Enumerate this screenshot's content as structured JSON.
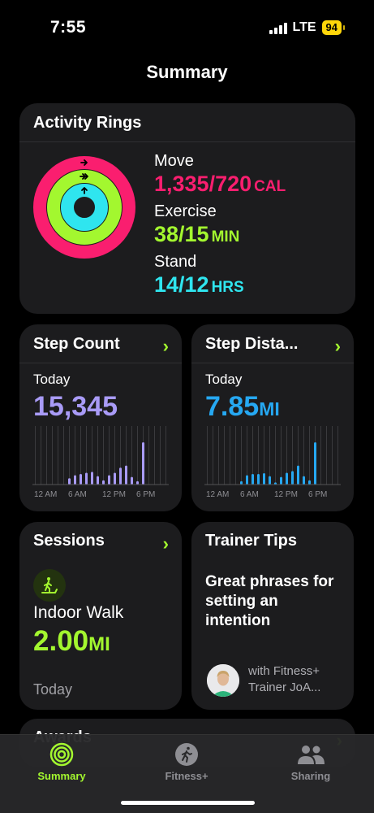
{
  "status": {
    "time": "7:55",
    "network": "LTE",
    "battery": "94"
  },
  "page_title": "Summary",
  "activity": {
    "title": "Activity Rings",
    "move": {
      "label": "Move",
      "value": "1,335/720",
      "unit": "CAL",
      "color": "#fa1e6f",
      "progress": 1.854
    },
    "exercise": {
      "label": "Exercise",
      "value": "38/15",
      "unit": "MIN",
      "color": "#a3f72f",
      "progress": 2.53
    },
    "stand": {
      "label": "Stand",
      "value": "14/12",
      "unit": "HRS",
      "color": "#2fe5ef",
      "progress": 1.167
    }
  },
  "step_count": {
    "title": "Step Count",
    "period": "Today",
    "value": "15,345",
    "color": "#a99bf7",
    "x_ticks": [
      "12 AM",
      "6 AM",
      "12 PM",
      "6 PM"
    ],
    "hourly": [
      0,
      0,
      0,
      0,
      0,
      0,
      0.15,
      0.22,
      0.25,
      0.28,
      0.3,
      0.2,
      0.1,
      0.22,
      0.28,
      0.4,
      0.45,
      0.18,
      0.08,
      1.0,
      0,
      0,
      0,
      0
    ]
  },
  "step_distance": {
    "title": "Step Dista...",
    "period": "Today",
    "value": "7.85",
    "unit": "MI",
    "color": "#26a8f2",
    "x_ticks": [
      "12 AM",
      "6 AM",
      "12 PM",
      "6 PM"
    ],
    "hourly": [
      0,
      0,
      0,
      0,
      0,
      0,
      0.08,
      0.22,
      0.25,
      0.25,
      0.27,
      0.2,
      0.05,
      0.18,
      0.28,
      0.32,
      0.45,
      0.2,
      0.1,
      1.0,
      0,
      0,
      0,
      0
    ]
  },
  "sessions": {
    "title": "Sessions",
    "workout": "Indoor Walk",
    "value": "2.00",
    "unit": "MI",
    "date": "Today",
    "icon": "indoor-walk-icon"
  },
  "trainer_tips": {
    "title": "Trainer Tips",
    "tip": "Great phrases for setting an intention",
    "line1": "with Fitness+",
    "line2": "Trainer JoA..."
  },
  "awards": {
    "title": "Awards"
  },
  "tabs": [
    {
      "label": "Summary",
      "active": true,
      "icon": "summary-rings-icon"
    },
    {
      "label": "Fitness+",
      "active": false,
      "icon": "fitness-plus-icon"
    },
    {
      "label": "Sharing",
      "active": false,
      "icon": "sharing-people-icon"
    }
  ]
}
